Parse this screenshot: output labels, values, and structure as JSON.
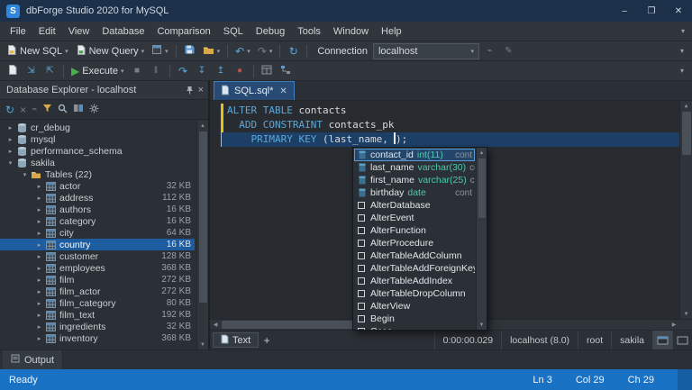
{
  "window": {
    "title": "dbForge Studio 2020 for MySQL",
    "logo_letter": "S",
    "controls": {
      "minimize": "–",
      "maximize": "❐",
      "close": "✕"
    }
  },
  "menu": {
    "items": [
      "File",
      "Edit",
      "View",
      "Database",
      "Comparison",
      "SQL",
      "Debug",
      "Tools",
      "Window",
      "Help"
    ]
  },
  "toolbars": {
    "new_sql_label": "New SQL",
    "new_query_label": "New Query",
    "connection_label": "Connection",
    "connection_value": "localhost",
    "execute_label": "Execute"
  },
  "explorer": {
    "title": "Database Explorer - localhost",
    "tree": [
      {
        "label": "cr_debug",
        "level": 1,
        "icon": "database",
        "expander": "collapsed"
      },
      {
        "label": "mysql",
        "level": 1,
        "icon": "database",
        "expander": "collapsed"
      },
      {
        "label": "performance_schema",
        "level": 1,
        "icon": "database",
        "expander": "collapsed"
      },
      {
        "label": "sakila",
        "level": 1,
        "icon": "database",
        "expander": "expanded"
      },
      {
        "label": "Tables (22)",
        "level": 2,
        "icon": "folder",
        "expander": "expanded"
      },
      {
        "label": "actor",
        "size": "32 KB",
        "level": 3,
        "icon": "table",
        "expander": "collapsed"
      },
      {
        "label": "address",
        "size": "112 KB",
        "level": 3,
        "icon": "table",
        "expander": "collapsed"
      },
      {
        "label": "authors",
        "size": "16 KB",
        "level": 3,
        "icon": "table",
        "expander": "collapsed"
      },
      {
        "label": "category",
        "size": "16 KB",
        "level": 3,
        "icon": "table",
        "expander": "collapsed"
      },
      {
        "label": "city",
        "size": "64 KB",
        "level": 3,
        "icon": "table",
        "expander": "collapsed"
      },
      {
        "label": "country",
        "size": "16 KB",
        "level": 3,
        "icon": "table",
        "expander": "collapsed",
        "selected": true
      },
      {
        "label": "customer",
        "size": "128 KB",
        "level": 3,
        "icon": "table",
        "expander": "collapsed"
      },
      {
        "label": "employees",
        "size": "368 KB",
        "level": 3,
        "icon": "table",
        "expander": "collapsed"
      },
      {
        "label": "film",
        "size": "272 KB",
        "level": 3,
        "icon": "table",
        "expander": "collapsed"
      },
      {
        "label": "film_actor",
        "size": "272 KB",
        "level": 3,
        "icon": "table",
        "expander": "collapsed"
      },
      {
        "label": "film_category",
        "size": "80 KB",
        "level": 3,
        "icon": "table",
        "expander": "collapsed"
      },
      {
        "label": "film_text",
        "size": "192 KB",
        "level": 3,
        "icon": "table",
        "expander": "collapsed"
      },
      {
        "label": "ingredients",
        "size": "32 KB",
        "level": 3,
        "icon": "table",
        "expander": "collapsed"
      },
      {
        "label": "inventory",
        "size": "368 KB",
        "level": 3,
        "icon": "table",
        "expander": "collapsed"
      }
    ]
  },
  "editor": {
    "tab_label": "SQL.sql*",
    "lines": [
      {
        "segments": [
          {
            "text": "ALTER TABLE ",
            "kind": "keyword"
          },
          {
            "text": "contacts",
            "kind": "plain"
          }
        ]
      },
      {
        "segments": [
          {
            "text": "  ",
            "kind": "plain"
          },
          {
            "text": "ADD CONSTRAINT",
            "kind": "keyword"
          },
          {
            "text": " contacts_pk",
            "kind": "plain"
          }
        ]
      },
      {
        "segments": [
          {
            "text": "    ",
            "kind": "plain"
          },
          {
            "text": "PRIMARY KEY",
            "kind": "keyword"
          },
          {
            "text": " (last_name, ",
            "kind": "plain"
          },
          {
            "caret": true
          },
          {
            "text": ");",
            "kind": "plain"
          }
        ],
        "current": true
      }
    ]
  },
  "autocomplete": {
    "items": [
      {
        "label": "contact_id",
        "type": "int(11)",
        "detail": "cont",
        "kind": "column",
        "selected": true
      },
      {
        "label": "last_name",
        "type": "varchar(30)",
        "detail": "cont",
        "kind": "column"
      },
      {
        "label": "first_name",
        "type": "varchar(25)",
        "detail": "cont",
        "kind": "column"
      },
      {
        "label": "birthday",
        "type": "date",
        "detail": "cont",
        "kind": "column"
      },
      {
        "label": "AlterDatabase",
        "kind": "snippet"
      },
      {
        "label": "AlterEvent",
        "kind": "snippet"
      },
      {
        "label": "AlterFunction",
        "kind": "snippet"
      },
      {
        "label": "AlterProcedure",
        "kind": "snippet"
      },
      {
        "label": "AlterTableAddColumn",
        "kind": "snippet"
      },
      {
        "label": "AlterTableAddForeignKey",
        "kind": "snippet"
      },
      {
        "label": "AlterTableAddIndex",
        "kind": "snippet"
      },
      {
        "label": "AlterTableDropColumn",
        "kind": "snippet"
      },
      {
        "label": "AlterView",
        "kind": "snippet"
      },
      {
        "label": "Begin",
        "kind": "snippet"
      },
      {
        "label": "Case",
        "kind": "snippet"
      }
    ]
  },
  "editor_status": {
    "view_tab": "Text",
    "add_tab": "+",
    "duration": "0:00:00.029",
    "connection": "localhost (8.0)",
    "user": "root",
    "database": "sakila"
  },
  "output": {
    "tab_label": "Output"
  },
  "statusbar": {
    "state": "Ready",
    "line": "Ln 3",
    "column": "Col 29",
    "char": "Ch 29"
  },
  "colors": {
    "titlebar": "#1c3149",
    "statusbar": "#1a72c4",
    "selection": "#1d5c9e",
    "keyword": "#5aa7da",
    "datatype": "#4ec9b0",
    "current_line": "#1d3f66",
    "changed_line_bar": "#e2c51a"
  }
}
